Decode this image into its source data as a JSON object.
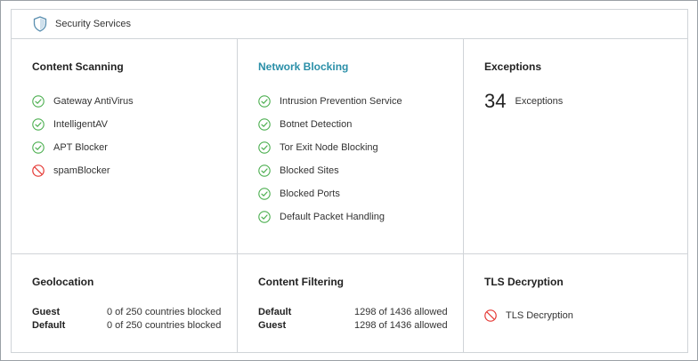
{
  "header": {
    "title": "Security Services",
    "icon": "shield-icon"
  },
  "colors": {
    "ok": "#4caf50",
    "blocked": "#e53935",
    "link": "#2a8fa8"
  },
  "content_scanning": {
    "title": "Content Scanning",
    "items": [
      {
        "label": "Gateway AntiVirus",
        "status": "enabled",
        "icon": "check-circle-icon"
      },
      {
        "label": "IntelligentAV",
        "status": "enabled",
        "icon": "check-circle-icon"
      },
      {
        "label": "APT Blocker",
        "status": "enabled",
        "icon": "check-circle-icon"
      },
      {
        "label": "spamBlocker",
        "status": "disabled",
        "icon": "blocked-circle-icon"
      }
    ]
  },
  "network_blocking": {
    "title": "Network Blocking",
    "items": [
      {
        "label": "Intrusion Prevention Service",
        "status": "enabled",
        "icon": "check-circle-icon"
      },
      {
        "label": "Botnet Detection",
        "status": "enabled",
        "icon": "check-circle-icon"
      },
      {
        "label": "Tor Exit Node Blocking",
        "status": "enabled",
        "icon": "check-circle-icon"
      },
      {
        "label": "Blocked Sites",
        "status": "enabled",
        "icon": "check-circle-icon"
      },
      {
        "label": "Blocked Ports",
        "status": "enabled",
        "icon": "check-circle-icon"
      },
      {
        "label": "Default Packet Handling",
        "status": "enabled",
        "icon": "check-circle-icon"
      }
    ]
  },
  "exceptions": {
    "title": "Exceptions",
    "count": "34",
    "label": "Exceptions"
  },
  "geolocation": {
    "title": "Geolocation",
    "rows": [
      {
        "key": "Guest",
        "value": "0 of 250 countries blocked"
      },
      {
        "key": "Default",
        "value": "0 of 250 countries blocked"
      }
    ]
  },
  "content_filtering": {
    "title": "Content Filtering",
    "rows": [
      {
        "key": "Default",
        "value": "1298 of 1436 allowed"
      },
      {
        "key": "Guest",
        "value": "1298 of 1436 allowed"
      }
    ]
  },
  "tls_decryption": {
    "title": "TLS Decryption",
    "items": [
      {
        "label": "TLS Decryption",
        "status": "disabled",
        "icon": "blocked-circle-icon"
      }
    ]
  }
}
